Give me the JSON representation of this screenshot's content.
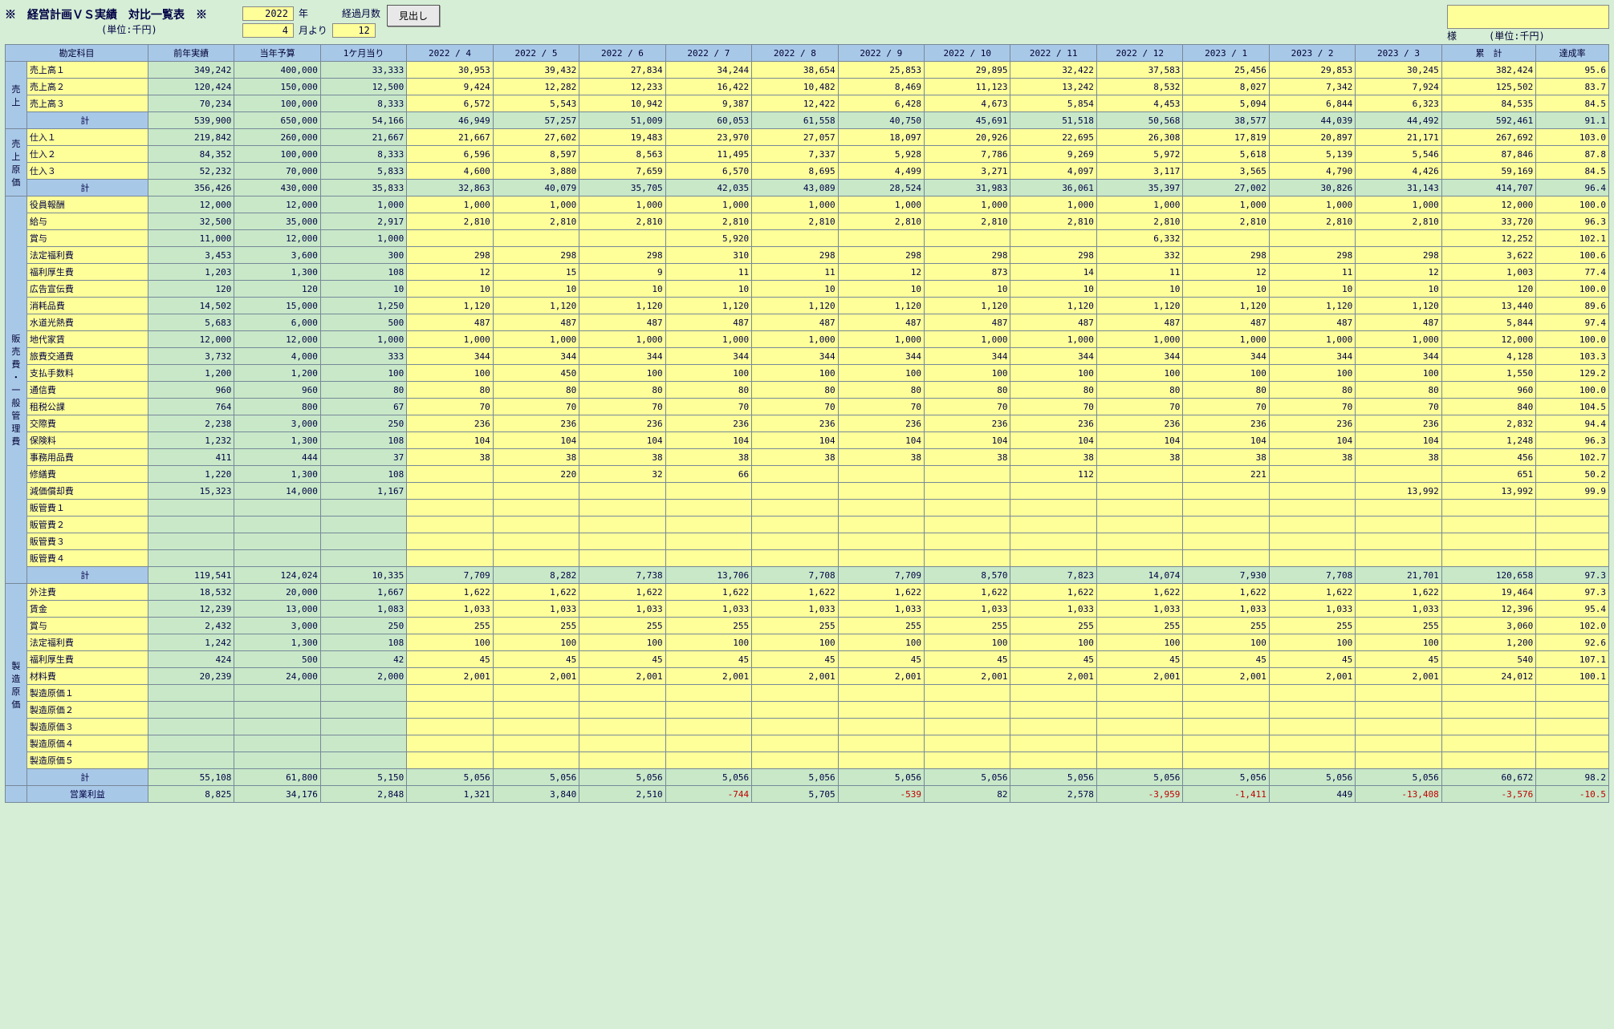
{
  "header": {
    "title": "※　経営計画ＶＳ実績　対比一覧表　※",
    "unit": "(単位:千円)",
    "year": "2022",
    "year_suffix": "年",
    "month": "4",
    "month_suffix": "月より",
    "elapsed_label": "経過月数",
    "elapsed": "12",
    "button": "見出し",
    "sama": "様",
    "unit2": "(単位:千円)"
  },
  "cols": {
    "account": "勘定科目",
    "prev": "前年実績",
    "budget": "当年予算",
    "permonth": "1ケ月当り",
    "months": [
      "2022 / 4",
      "2022 / 5",
      "2022 / 6",
      "2022 / 7",
      "2022 / 8",
      "2022 / 9",
      "2022 / 10",
      "2022 / 11",
      "2022 / 12",
      "2023 / 1",
      "2023 / 2",
      "2023 / 3"
    ],
    "total": "累　計",
    "rate": "達成率"
  },
  "vcats": [
    "売上",
    "売上原価",
    "販売費・一般管理費",
    "製造原価",
    ""
  ],
  "rows": [
    {
      "g": 0,
      "cls": "yellow",
      "lbl": "売上高１",
      "py": "349,242",
      "bud": "400,000",
      "pm": "33,333",
      "m": [
        "30,953",
        "39,432",
        "27,834",
        "34,244",
        "38,654",
        "25,853",
        "29,895",
        "32,422",
        "37,583",
        "25,456",
        "29,853",
        "30,245"
      ],
      "tot": "382,424",
      "rate": "95.6"
    },
    {
      "g": 0,
      "cls": "yellow",
      "lbl": "売上高２",
      "py": "120,424",
      "bud": "150,000",
      "pm": "12,500",
      "m": [
        "9,424",
        "12,282",
        "12,233",
        "16,422",
        "10,482",
        "8,469",
        "11,123",
        "13,242",
        "8,532",
        "8,027",
        "7,342",
        "7,924"
      ],
      "tot": "125,502",
      "rate": "83.7"
    },
    {
      "g": 0,
      "cls": "yellow",
      "lbl": "売上高３",
      "py": "70,234",
      "bud": "100,000",
      "pm": "8,333",
      "m": [
        "6,572",
        "5,543",
        "10,942",
        "9,387",
        "12,422",
        "6,428",
        "4,673",
        "5,854",
        "4,453",
        "5,094",
        "6,844",
        "6,323"
      ],
      "tot": "84,535",
      "rate": "84.5"
    },
    {
      "g": 0,
      "cls": "subtotal",
      "lbl": "計",
      "py": "539,900",
      "bud": "650,000",
      "pm": "54,166",
      "m": [
        "46,949",
        "57,257",
        "51,009",
        "60,053",
        "61,558",
        "40,750",
        "45,691",
        "51,518",
        "50,568",
        "38,577",
        "44,039",
        "44,492"
      ],
      "tot": "592,461",
      "rate": "91.1"
    },
    {
      "g": 1,
      "cls": "yellow",
      "lbl": "仕入１",
      "py": "219,842",
      "bud": "260,000",
      "pm": "21,667",
      "m": [
        "21,667",
        "27,602",
        "19,483",
        "23,970",
        "27,057",
        "18,097",
        "20,926",
        "22,695",
        "26,308",
        "17,819",
        "20,897",
        "21,171"
      ],
      "tot": "267,692",
      "rate": "103.0"
    },
    {
      "g": 1,
      "cls": "yellow",
      "lbl": "仕入２",
      "py": "84,352",
      "bud": "100,000",
      "pm": "8,333",
      "m": [
        "6,596",
        "8,597",
        "8,563",
        "11,495",
        "7,337",
        "5,928",
        "7,786",
        "9,269",
        "5,972",
        "5,618",
        "5,139",
        "5,546"
      ],
      "tot": "87,846",
      "rate": "87.8"
    },
    {
      "g": 1,
      "cls": "yellow",
      "lbl": "仕入３",
      "py": "52,232",
      "bud": "70,000",
      "pm": "5,833",
      "m": [
        "4,600",
        "3,880",
        "7,659",
        "6,570",
        "8,695",
        "4,499",
        "3,271",
        "4,097",
        "3,117",
        "3,565",
        "4,790",
        "4,426"
      ],
      "tot": "59,169",
      "rate": "84.5"
    },
    {
      "g": 1,
      "cls": "subtotal",
      "lbl": "計",
      "py": "356,426",
      "bud": "430,000",
      "pm": "35,833",
      "m": [
        "32,863",
        "40,079",
        "35,705",
        "42,035",
        "43,089",
        "28,524",
        "31,983",
        "36,061",
        "35,397",
        "27,002",
        "30,826",
        "31,143"
      ],
      "tot": "414,707",
      "rate": "96.4"
    },
    {
      "g": 2,
      "cls": "yellow",
      "lbl": "役員報酬",
      "py": "12,000",
      "bud": "12,000",
      "pm": "1,000",
      "m": [
        "1,000",
        "1,000",
        "1,000",
        "1,000",
        "1,000",
        "1,000",
        "1,000",
        "1,000",
        "1,000",
        "1,000",
        "1,000",
        "1,000"
      ],
      "tot": "12,000",
      "rate": "100.0"
    },
    {
      "g": 2,
      "cls": "yellow",
      "lbl": "給与",
      "py": "32,500",
      "bud": "35,000",
      "pm": "2,917",
      "m": [
        "2,810",
        "2,810",
        "2,810",
        "2,810",
        "2,810",
        "2,810",
        "2,810",
        "2,810",
        "2,810",
        "2,810",
        "2,810",
        "2,810"
      ],
      "tot": "33,720",
      "rate": "96.3"
    },
    {
      "g": 2,
      "cls": "yellow",
      "lbl": "賞与",
      "py": "11,000",
      "bud": "12,000",
      "pm": "1,000",
      "m": [
        "",
        "",
        "",
        "5,920",
        "",
        "",
        "",
        "",
        "6,332",
        "",
        "",
        ""
      ],
      "tot": "12,252",
      "rate": "102.1"
    },
    {
      "g": 2,
      "cls": "yellow",
      "lbl": "法定福利費",
      "py": "3,453",
      "bud": "3,600",
      "pm": "300",
      "m": [
        "298",
        "298",
        "298",
        "310",
        "298",
        "298",
        "298",
        "298",
        "332",
        "298",
        "298",
        "298"
      ],
      "tot": "3,622",
      "rate": "100.6"
    },
    {
      "g": 2,
      "cls": "yellow",
      "lbl": "福利厚生費",
      "py": "1,203",
      "bud": "1,300",
      "pm": "108",
      "m": [
        "12",
        "15",
        "9",
        "11",
        "11",
        "12",
        "873",
        "14",
        "11",
        "12",
        "11",
        "12"
      ],
      "tot": "1,003",
      "rate": "77.4"
    },
    {
      "g": 2,
      "cls": "yellow",
      "lbl": "広告宣伝費",
      "py": "120",
      "bud": "120",
      "pm": "10",
      "m": [
        "10",
        "10",
        "10",
        "10",
        "10",
        "10",
        "10",
        "10",
        "10",
        "10",
        "10",
        "10"
      ],
      "tot": "120",
      "rate": "100.0"
    },
    {
      "g": 2,
      "cls": "yellow",
      "lbl": "消耗品費",
      "py": "14,502",
      "bud": "15,000",
      "pm": "1,250",
      "m": [
        "1,120",
        "1,120",
        "1,120",
        "1,120",
        "1,120",
        "1,120",
        "1,120",
        "1,120",
        "1,120",
        "1,120",
        "1,120",
        "1,120"
      ],
      "tot": "13,440",
      "rate": "89.6"
    },
    {
      "g": 2,
      "cls": "yellow",
      "lbl": "水道光熱費",
      "py": "5,683",
      "bud": "6,000",
      "pm": "500",
      "m": [
        "487",
        "487",
        "487",
        "487",
        "487",
        "487",
        "487",
        "487",
        "487",
        "487",
        "487",
        "487"
      ],
      "tot": "5,844",
      "rate": "97.4"
    },
    {
      "g": 2,
      "cls": "yellow",
      "lbl": "地代家賃",
      "py": "12,000",
      "bud": "12,000",
      "pm": "1,000",
      "m": [
        "1,000",
        "1,000",
        "1,000",
        "1,000",
        "1,000",
        "1,000",
        "1,000",
        "1,000",
        "1,000",
        "1,000",
        "1,000",
        "1,000"
      ],
      "tot": "12,000",
      "rate": "100.0"
    },
    {
      "g": 2,
      "cls": "yellow",
      "lbl": "旅費交通費",
      "py": "3,732",
      "bud": "4,000",
      "pm": "333",
      "m": [
        "344",
        "344",
        "344",
        "344",
        "344",
        "344",
        "344",
        "344",
        "344",
        "344",
        "344",
        "344"
      ],
      "tot": "4,128",
      "rate": "103.3"
    },
    {
      "g": 2,
      "cls": "yellow",
      "lbl": "支払手数料",
      "py": "1,200",
      "bud": "1,200",
      "pm": "100",
      "m": [
        "100",
        "450",
        "100",
        "100",
        "100",
        "100",
        "100",
        "100",
        "100",
        "100",
        "100",
        "100"
      ],
      "tot": "1,550",
      "rate": "129.2"
    },
    {
      "g": 2,
      "cls": "yellow",
      "lbl": "通信費",
      "py": "960",
      "bud": "960",
      "pm": "80",
      "m": [
        "80",
        "80",
        "80",
        "80",
        "80",
        "80",
        "80",
        "80",
        "80",
        "80",
        "80",
        "80"
      ],
      "tot": "960",
      "rate": "100.0"
    },
    {
      "g": 2,
      "cls": "yellow",
      "lbl": "租税公課",
      "py": "764",
      "bud": "800",
      "pm": "67",
      "m": [
        "70",
        "70",
        "70",
        "70",
        "70",
        "70",
        "70",
        "70",
        "70",
        "70",
        "70",
        "70"
      ],
      "tot": "840",
      "rate": "104.5"
    },
    {
      "g": 2,
      "cls": "yellow",
      "lbl": "交際費",
      "py": "2,238",
      "bud": "3,000",
      "pm": "250",
      "m": [
        "236",
        "236",
        "236",
        "236",
        "236",
        "236",
        "236",
        "236",
        "236",
        "236",
        "236",
        "236"
      ],
      "tot": "2,832",
      "rate": "94.4"
    },
    {
      "g": 2,
      "cls": "yellow",
      "lbl": "保険料",
      "py": "1,232",
      "bud": "1,300",
      "pm": "108",
      "m": [
        "104",
        "104",
        "104",
        "104",
        "104",
        "104",
        "104",
        "104",
        "104",
        "104",
        "104",
        "104"
      ],
      "tot": "1,248",
      "rate": "96.3"
    },
    {
      "g": 2,
      "cls": "yellow",
      "lbl": "事務用品費",
      "py": "411",
      "bud": "444",
      "pm": "37",
      "m": [
        "38",
        "38",
        "38",
        "38",
        "38",
        "38",
        "38",
        "38",
        "38",
        "38",
        "38",
        "38"
      ],
      "tot": "456",
      "rate": "102.7"
    },
    {
      "g": 2,
      "cls": "yellow",
      "lbl": "修繕費",
      "py": "1,220",
      "bud": "1,300",
      "pm": "108",
      "m": [
        "",
        "220",
        "32",
        "66",
        "",
        "",
        "",
        "112",
        "",
        "221",
        "",
        ""
      ],
      "tot": "651",
      "rate": "50.2"
    },
    {
      "g": 2,
      "cls": "yellow",
      "lbl": "減価償却費",
      "py": "15,323",
      "bud": "14,000",
      "pm": "1,167",
      "m": [
        "",
        "",
        "",
        "",
        "",
        "",
        "",
        "",
        "",
        "",
        "",
        "13,992"
      ],
      "tot": "13,992",
      "rate": "99.9"
    },
    {
      "g": 2,
      "cls": "yellow",
      "lbl": "販管費１",
      "py": "",
      "bud": "",
      "pm": "",
      "m": [
        "",
        "",
        "",
        "",
        "",
        "",
        "",
        "",
        "",
        "",
        "",
        ""
      ],
      "tot": "",
      "rate": ""
    },
    {
      "g": 2,
      "cls": "yellow",
      "lbl": "販管費２",
      "py": "",
      "bud": "",
      "pm": "",
      "m": [
        "",
        "",
        "",
        "",
        "",
        "",
        "",
        "",
        "",
        "",
        "",
        ""
      ],
      "tot": "",
      "rate": ""
    },
    {
      "g": 2,
      "cls": "yellow",
      "lbl": "販管費３",
      "py": "",
      "bud": "",
      "pm": "",
      "m": [
        "",
        "",
        "",
        "",
        "",
        "",
        "",
        "",
        "",
        "",
        "",
        ""
      ],
      "tot": "",
      "rate": ""
    },
    {
      "g": 2,
      "cls": "yellow",
      "lbl": "販管費４",
      "py": "",
      "bud": "",
      "pm": "",
      "m": [
        "",
        "",
        "",
        "",
        "",
        "",
        "",
        "",
        "",
        "",
        "",
        ""
      ],
      "tot": "",
      "rate": ""
    },
    {
      "g": 2,
      "cls": "subtotal",
      "lbl": "計",
      "py": "119,541",
      "bud": "124,024",
      "pm": "10,335",
      "m": [
        "7,709",
        "8,282",
        "7,738",
        "13,706",
        "7,708",
        "7,709",
        "8,570",
        "7,823",
        "14,074",
        "7,930",
        "7,708",
        "21,701"
      ],
      "tot": "120,658",
      "rate": "97.3"
    },
    {
      "g": 3,
      "cls": "yellow",
      "lbl": "外注費",
      "py": "18,532",
      "bud": "20,000",
      "pm": "1,667",
      "m": [
        "1,622",
        "1,622",
        "1,622",
        "1,622",
        "1,622",
        "1,622",
        "1,622",
        "1,622",
        "1,622",
        "1,622",
        "1,622",
        "1,622"
      ],
      "tot": "19,464",
      "rate": "97.3"
    },
    {
      "g": 3,
      "cls": "yellow",
      "lbl": "賃金",
      "py": "12,239",
      "bud": "13,000",
      "pm": "1,083",
      "m": [
        "1,033",
        "1,033",
        "1,033",
        "1,033",
        "1,033",
        "1,033",
        "1,033",
        "1,033",
        "1,033",
        "1,033",
        "1,033",
        "1,033"
      ],
      "tot": "12,396",
      "rate": "95.4"
    },
    {
      "g": 3,
      "cls": "yellow",
      "lbl": "賞与",
      "py": "2,432",
      "bud": "3,000",
      "pm": "250",
      "m": [
        "255",
        "255",
        "255",
        "255",
        "255",
        "255",
        "255",
        "255",
        "255",
        "255",
        "255",
        "255"
      ],
      "tot": "3,060",
      "rate": "102.0"
    },
    {
      "g": 3,
      "cls": "yellow",
      "lbl": "法定福利費",
      "py": "1,242",
      "bud": "1,300",
      "pm": "108",
      "m": [
        "100",
        "100",
        "100",
        "100",
        "100",
        "100",
        "100",
        "100",
        "100",
        "100",
        "100",
        "100"
      ],
      "tot": "1,200",
      "rate": "92.6"
    },
    {
      "g": 3,
      "cls": "yellow",
      "lbl": "福利厚生費",
      "py": "424",
      "bud": "500",
      "pm": "42",
      "m": [
        "45",
        "45",
        "45",
        "45",
        "45",
        "45",
        "45",
        "45",
        "45",
        "45",
        "45",
        "45"
      ],
      "tot": "540",
      "rate": "107.1"
    },
    {
      "g": 3,
      "cls": "yellow",
      "lbl": "材料費",
      "py": "20,239",
      "bud": "24,000",
      "pm": "2,000",
      "m": [
        "2,001",
        "2,001",
        "2,001",
        "2,001",
        "2,001",
        "2,001",
        "2,001",
        "2,001",
        "2,001",
        "2,001",
        "2,001",
        "2,001"
      ],
      "tot": "24,012",
      "rate": "100.1"
    },
    {
      "g": 3,
      "cls": "yellow",
      "lbl": "製造原価１",
      "py": "",
      "bud": "",
      "pm": "",
      "m": [
        "",
        "",
        "",
        "",
        "",
        "",
        "",
        "",
        "",
        "",
        "",
        ""
      ],
      "tot": "",
      "rate": ""
    },
    {
      "g": 3,
      "cls": "yellow",
      "lbl": "製造原価２",
      "py": "",
      "bud": "",
      "pm": "",
      "m": [
        "",
        "",
        "",
        "",
        "",
        "",
        "",
        "",
        "",
        "",
        "",
        ""
      ],
      "tot": "",
      "rate": ""
    },
    {
      "g": 3,
      "cls": "yellow",
      "lbl": "製造原価３",
      "py": "",
      "bud": "",
      "pm": "",
      "m": [
        "",
        "",
        "",
        "",
        "",
        "",
        "",
        "",
        "",
        "",
        "",
        ""
      ],
      "tot": "",
      "rate": ""
    },
    {
      "g": 3,
      "cls": "yellow",
      "lbl": "製造原価４",
      "py": "",
      "bud": "",
      "pm": "",
      "m": [
        "",
        "",
        "",
        "",
        "",
        "",
        "",
        "",
        "",
        "",
        "",
        ""
      ],
      "tot": "",
      "rate": ""
    },
    {
      "g": 3,
      "cls": "yellow",
      "lbl": "製造原価５",
      "py": "",
      "bud": "",
      "pm": "",
      "m": [
        "",
        "",
        "",
        "",
        "",
        "",
        "",
        "",
        "",
        "",
        "",
        ""
      ],
      "tot": "",
      "rate": ""
    },
    {
      "g": 3,
      "cls": "subtotal",
      "lbl": "計",
      "py": "55,108",
      "bud": "61,800",
      "pm": "5,150",
      "m": [
        "5,056",
        "5,056",
        "5,056",
        "5,056",
        "5,056",
        "5,056",
        "5,056",
        "5,056",
        "5,056",
        "5,056",
        "5,056",
        "5,056"
      ],
      "tot": "60,672",
      "rate": "98.2"
    },
    {
      "g": 4,
      "cls": "green",
      "lbl": "営業利益",
      "py": "8,825",
      "bud": "34,176",
      "pm": "2,848",
      "m": [
        "1,321",
        "3,840",
        "2,510",
        "-744",
        "5,705",
        "-539",
        "82",
        "2,578",
        "-3,959",
        "-1,411",
        "449",
        "-13,408"
      ],
      "tot": "-3,576",
      "rate": "-10.5"
    }
  ]
}
